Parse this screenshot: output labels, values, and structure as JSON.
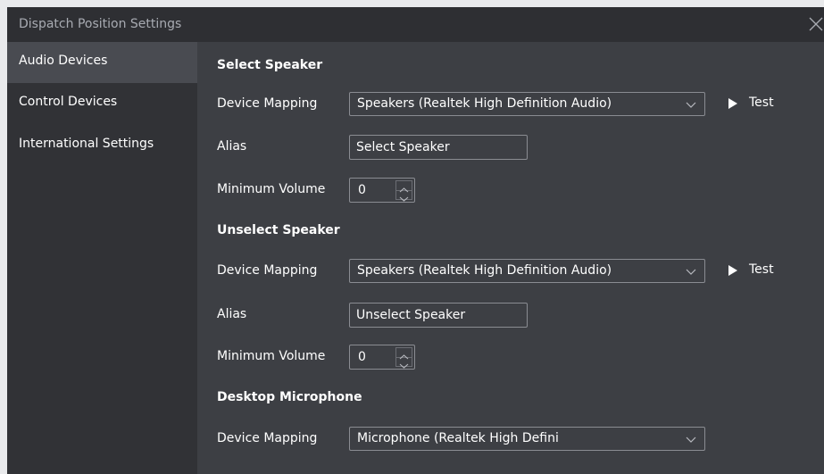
{
  "window": {
    "title": "Dispatch Position Settings"
  },
  "sidebar": {
    "items": [
      {
        "label": "Audio Devices"
      },
      {
        "label": "Control Devices"
      },
      {
        "label": "International Settings"
      }
    ]
  },
  "sections": [
    {
      "title": "Select Speaker",
      "device_mapping_label": "Device Mapping",
      "device_mapping_value": "Speakers (Realtek High Definition Audio)",
      "test_label": "Test",
      "alias_label": "Alias",
      "alias_value": "Select Speaker",
      "min_volume_label": "Minimum Volume",
      "min_volume_value": "0"
    },
    {
      "title": "Unselect Speaker",
      "device_mapping_label": "Device Mapping",
      "device_mapping_value": "Speakers (Realtek High Definition Audio)",
      "test_label": "Test",
      "alias_label": "Alias",
      "alias_value": "Unselect Speaker",
      "min_volume_label": "Minimum Volume",
      "min_volume_value": "0"
    },
    {
      "title": "Desktop Microphone",
      "device_mapping_label": "Device Mapping",
      "device_mapping_value": "Microphone (Realtek High Defini"
    }
  ],
  "icons": {
    "close": "close-icon",
    "dropdown": "chevron-down-icon",
    "test": "play-icon",
    "spin_up": "chevron-up-icon",
    "spin_down": "chevron-down-icon"
  },
  "colors": {
    "title_bar": "#2e2f33",
    "sidebar": "#313236",
    "sidebar_active": "#494b51",
    "content": "#3d3f44",
    "border": "#8a8c92"
  }
}
